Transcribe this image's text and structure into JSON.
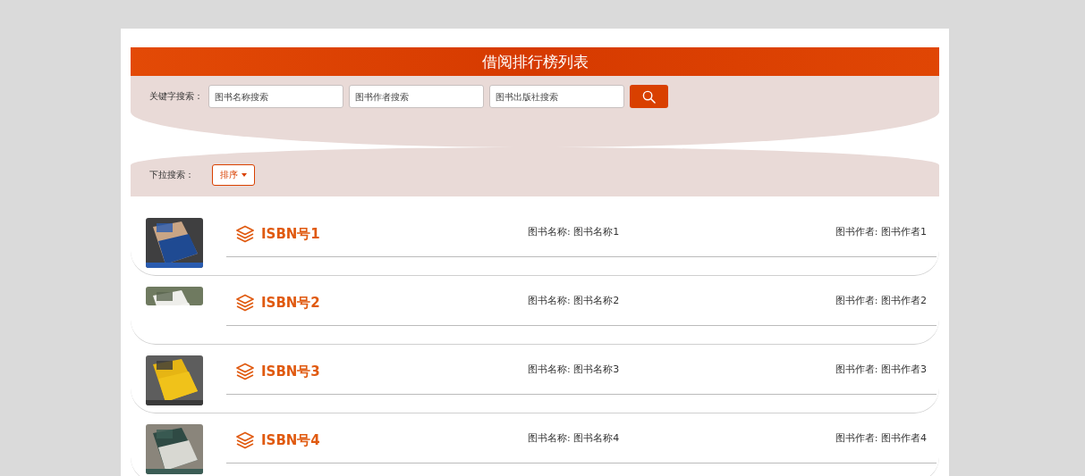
{
  "header": {
    "title": "借阅排行榜列表"
  },
  "keyword_search": {
    "label": "关键字搜索：",
    "fields": [
      {
        "placeholder": "图书名称搜索"
      },
      {
        "placeholder": "图书作者搜索"
      },
      {
        "placeholder": "图书出版社搜索"
      }
    ]
  },
  "dropdown_search": {
    "label": "下拉搜索：",
    "button": "排序"
  },
  "books": [
    {
      "isbn": "ISBN号1",
      "name": "图书名称: 图书名称1",
      "author": "图书作者: 图书作者1"
    },
    {
      "isbn": "ISBN号2",
      "name": "图书名称: 图书名称2",
      "author": "图书作者: 图书作者2"
    },
    {
      "isbn": "ISBN号3",
      "name": "图书名称: 图书名称3",
      "author": "图书作者: 图书作者3"
    },
    {
      "isbn": "ISBN号4",
      "name": "图书名称: 图书名称4",
      "author": "图书作者: 图书作者4"
    }
  ]
}
